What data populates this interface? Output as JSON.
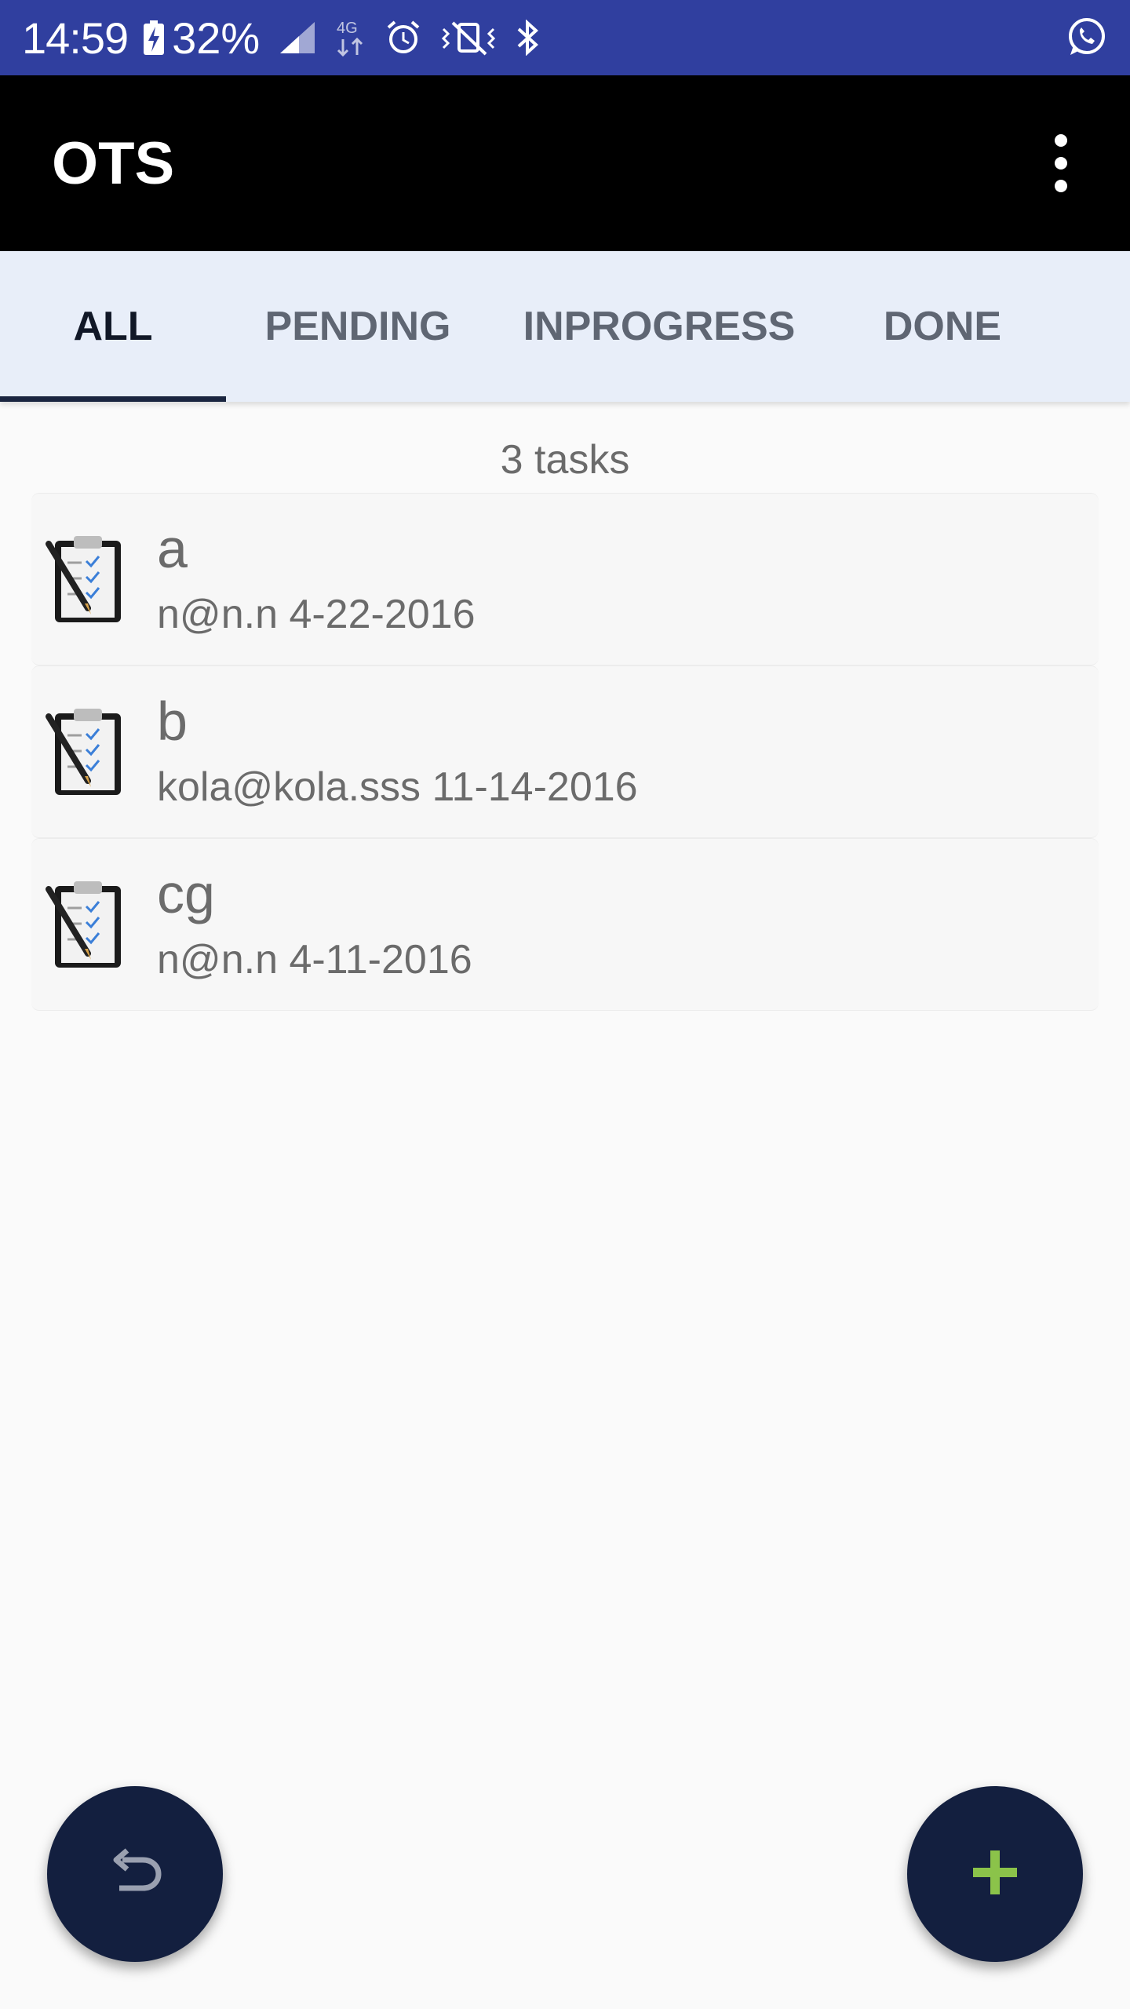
{
  "status_bar": {
    "time": "14:59",
    "battery": "32%",
    "network": "4G"
  },
  "app_bar": {
    "title": "OTS"
  },
  "tabs": [
    {
      "label": "ALL",
      "active": true
    },
    {
      "label": "PENDING",
      "active": false
    },
    {
      "label": "INPROGRESS",
      "active": false
    },
    {
      "label": "DONE",
      "active": false
    }
  ],
  "task_count": "3 tasks",
  "tasks": [
    {
      "title": "a",
      "subtitle": "n@n.n 4-22-2016",
      "icon": "clipboard-checklist-icon"
    },
    {
      "title": "b",
      "subtitle": "kola@kola.sss 11-14-2016",
      "icon": "clipboard-checklist-icon"
    },
    {
      "title": "cg",
      "subtitle": "n@n.n 4-11-2016",
      "icon": "clipboard-checklist-icon"
    }
  ],
  "fabs": {
    "undo_icon": "undo-icon",
    "add_icon": "plus-icon"
  },
  "colors": {
    "status_bar": "#303f9f",
    "app_bar": "#000000",
    "tab_bar": "#e8eef9",
    "fab": "#131f3f",
    "fab_plus": "#8bc34a"
  }
}
